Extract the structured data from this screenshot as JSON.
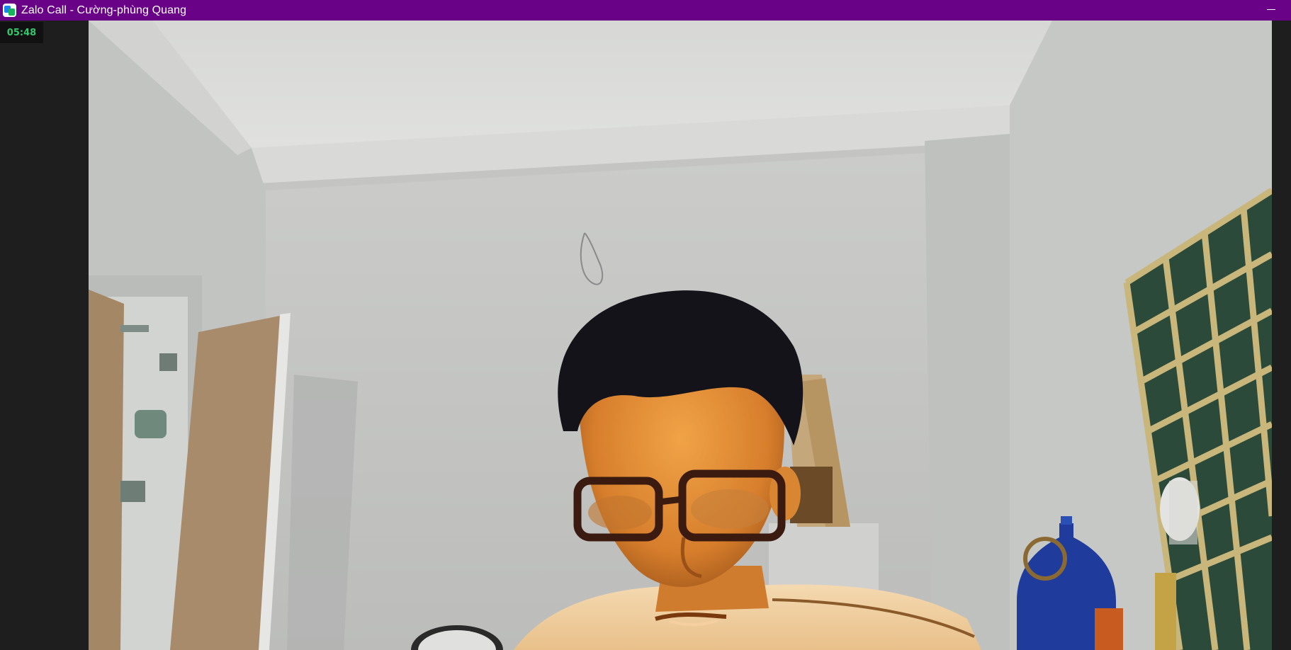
{
  "window": {
    "title": "Zalo Call - Cường-phùng Quang",
    "app_icon": "zalo-app-icon",
    "minimize_icon": "minimize-icon",
    "titlebar_color": "#6a0288"
  },
  "call": {
    "timer": "05:48",
    "timer_color": "#35c76b"
  },
  "video": {
    "stream": "remote-camera-video"
  }
}
